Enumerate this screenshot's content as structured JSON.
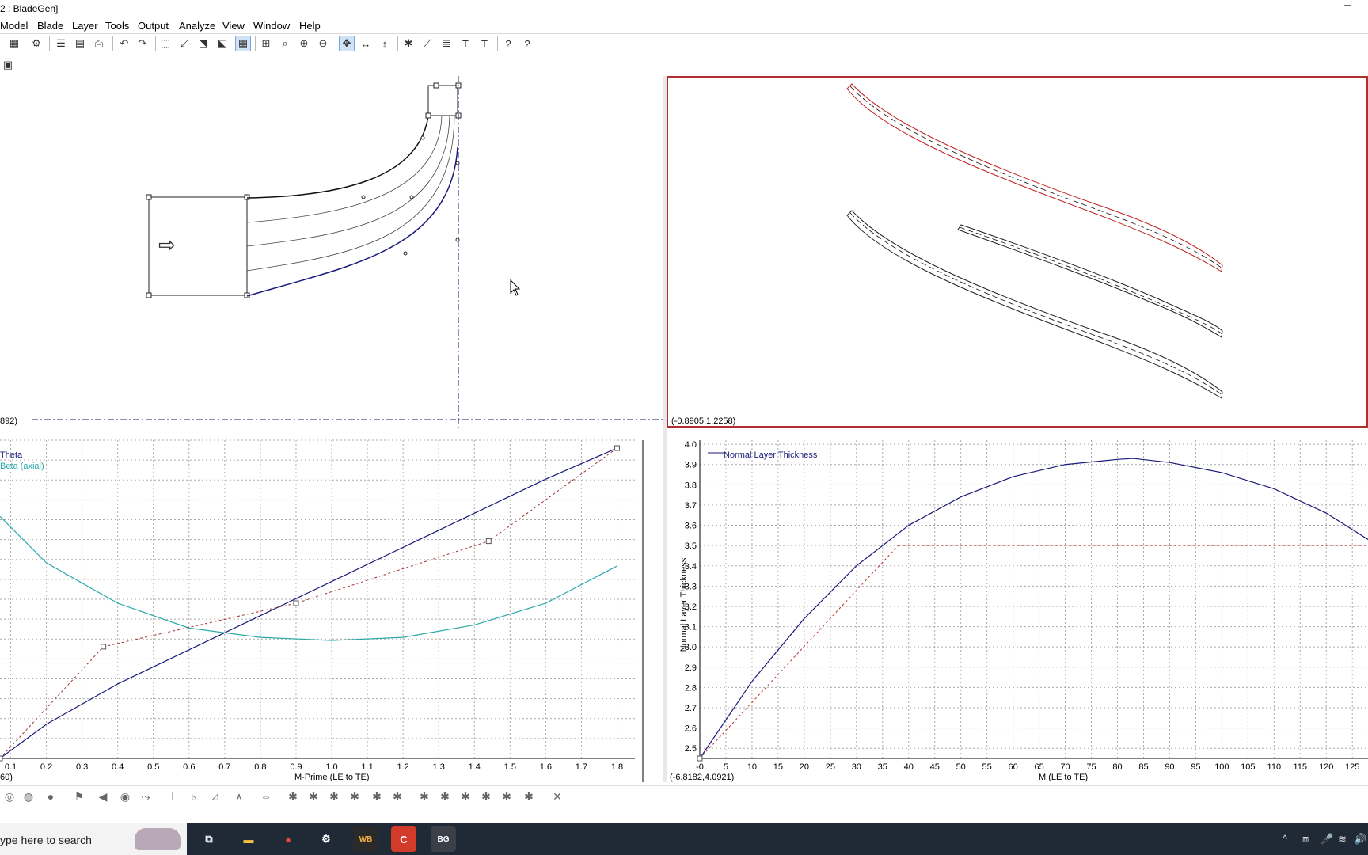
{
  "window": {
    "title": "2 : BladeGen]",
    "minimize_glyph": "–"
  },
  "menu": [
    "Model",
    "Blade",
    "Layer",
    "Tools",
    "Output",
    "Analyze",
    "View",
    "Window",
    "Help"
  ],
  "toolbar": {
    "icons": [
      "new-model-icon",
      "open-icon",
      "properties-icon",
      "layers-icon",
      "table-icon",
      "print-icon",
      "undo-icon",
      "redo-icon",
      "zoom-region-icon",
      "fit-icon",
      "expand-icon",
      "shrink-icon",
      "grid-icon",
      "fit-all-icon",
      "zoom-box-icon",
      "zoom-in-icon",
      "zoom-out-icon",
      "pan-icon",
      "pan-horizontal-icon",
      "pan-vertical-icon",
      "split-icon",
      "measure-icon",
      "stack-icon",
      "text-icon",
      "text-alt-icon",
      "context-help-icon",
      "help-icon"
    ]
  },
  "panes": {
    "meridional": {
      "coord": "892)",
      "arrow": "⇨"
    },
    "blade_to_blade": {
      "coord": "(-0.8905,1.2258)"
    },
    "angle": {
      "coord": "60)",
      "legend": [
        "Theta",
        "Beta (axial)"
      ],
      "xlabel": "M-Prime (LE to TE)"
    },
    "thickness": {
      "coord": "(-6.8182,4.0921)",
      "legend": "Normal Layer Thickness",
      "xlabel": "M (LE to TE)",
      "ylabel": "Normal Layer Thickness"
    }
  },
  "chart_data": [
    {
      "type": "line",
      "title": "",
      "xlabel": "M-Prime (LE to TE)",
      "ylabel": "",
      "x_ticks": [
        "0.1",
        "0.2",
        "0.3",
        "0.4",
        "0.5",
        "0.6",
        "0.7",
        "0.8",
        "0.9",
        "1.0",
        "1.1",
        "1.2",
        "1.3",
        "1.4",
        "1.5",
        "1.6",
        "1.7",
        "1.8"
      ],
      "xlim": [
        0.07,
        1.85
      ],
      "grid": true,
      "legend": "top-left",
      "series": [
        {
          "name": "Theta",
          "color": "#1a1a7a",
          "x": [
            0.07,
            0.2,
            0.4,
            0.6,
            0.8,
            1.0,
            1.2,
            1.4,
            1.6,
            1.8
          ],
          "y": [
            0.0,
            0.11,
            0.24,
            0.35,
            0.46,
            0.57,
            0.68,
            0.79,
            0.9,
            1.0
          ]
        },
        {
          "name": "Beta (axial)",
          "color": "#2aa8a8",
          "x": [
            0.07,
            0.2,
            0.4,
            0.6,
            0.8,
            1.0,
            1.2,
            1.4,
            1.6,
            1.8
          ],
          "y": [
            0.78,
            0.63,
            0.5,
            0.42,
            0.39,
            0.38,
            0.39,
            0.43,
            0.5,
            0.62
          ]
        }
      ]
    },
    {
      "type": "line",
      "title": "",
      "xlabel": "M (LE to TE)",
      "ylabel": "Normal Layer Thickness",
      "x_ticks": [
        "-0",
        "5",
        "10",
        "15",
        "20",
        "25",
        "30",
        "35",
        "40",
        "45",
        "50",
        "55",
        "60",
        "65",
        "70",
        "75",
        "80",
        "85",
        "90",
        "95",
        "100",
        "105",
        "110",
        "115",
        "120",
        "125"
      ],
      "y_ticks": [
        "2.5",
        "2.6",
        "2.7",
        "2.8",
        "2.9",
        "3.0",
        "3.1",
        "3.2",
        "3.3",
        "3.4",
        "3.5",
        "3.6",
        "3.7",
        "3.8",
        "3.9",
        "4.0"
      ],
      "xlim": [
        0,
        128
      ],
      "ylim": [
        2.45,
        4.02
      ],
      "grid": true,
      "legend": "top-left",
      "series": [
        {
          "name": "Normal Layer Thickness",
          "color": "#1a1a7a",
          "x": [
            0,
            10,
            20,
            30,
            40,
            50,
            60,
            70,
            80,
            83,
            90,
            100,
            110,
            120,
            128
          ],
          "y": [
            2.45,
            2.83,
            3.14,
            3.4,
            3.6,
            3.74,
            3.84,
            3.9,
            3.925,
            3.93,
            3.91,
            3.86,
            3.78,
            3.66,
            3.53
          ]
        }
      ],
      "reference_line": 3.5
    }
  ],
  "bottom_toolbar": [
    "globe-outline-icon",
    "globe-icon",
    "sphere-icon",
    "blade-icon",
    "prev-icon",
    "circle-icon",
    "flow-icon",
    "axis-icon",
    "axis2-icon",
    "axis3-icon",
    "fork-icon",
    "stretch-icon",
    "gear1-icon",
    "gear2-icon",
    "gear3-icon",
    "gear4-icon",
    "gear5-icon",
    "gear6-icon",
    "gear7-icon",
    "gear8-icon",
    "gear9-icon",
    "gear10-icon",
    "gear11-icon",
    "gear12-icon",
    "cross-icon"
  ],
  "taskbar": {
    "search_placeholder": "ype here to search",
    "apps": [
      {
        "name": "task-view-icon",
        "label": "⧉"
      },
      {
        "name": "file-explorer-icon",
        "label": "▬"
      },
      {
        "name": "chrome-icon",
        "label": "●"
      },
      {
        "name": "settings-icon",
        "label": "⚙"
      },
      {
        "name": "workbench-icon",
        "label": "WB"
      },
      {
        "name": "app-c-icon",
        "label": "C"
      },
      {
        "name": "bladegen-icon",
        "label": "BG"
      }
    ],
    "tray": [
      "^",
      "⧈",
      "🎤",
      "≋",
      "🔊"
    ]
  }
}
